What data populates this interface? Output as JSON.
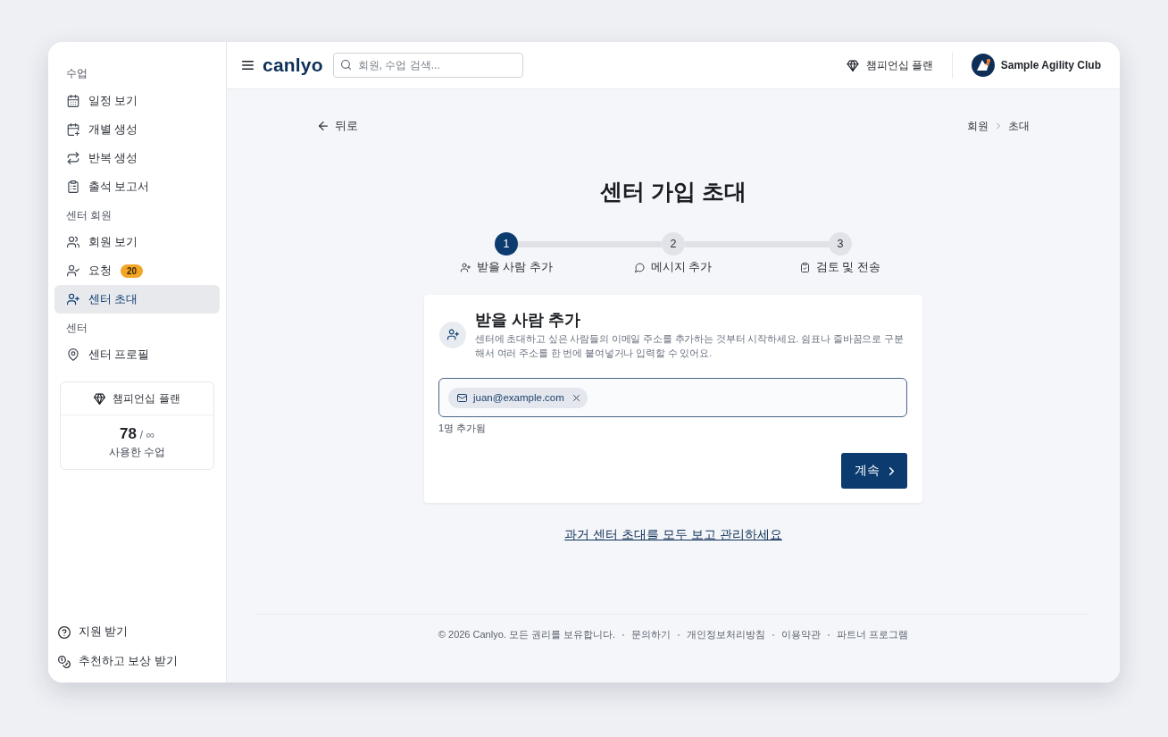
{
  "sidebar": {
    "sections": [
      {
        "heading": "수업",
        "items": [
          {
            "label": "일정 보기",
            "selected": false
          },
          {
            "label": "개별 생성",
            "selected": false
          },
          {
            "label": "반복 생성",
            "selected": false
          },
          {
            "label": "출석 보고서",
            "selected": false
          }
        ]
      },
      {
        "heading": "센터 회원",
        "items": [
          {
            "label": "회원 보기",
            "selected": false
          },
          {
            "label": "요청",
            "badge": "20",
            "selected": false
          },
          {
            "label": "센터 초대",
            "selected": true
          }
        ]
      },
      {
        "heading": "센터",
        "items": [
          {
            "label": "센터 프로필",
            "selected": false
          }
        ]
      }
    ],
    "plan_card": {
      "title": "챔피언십 플랜",
      "usage": "**78** / ∞",
      "caption": "사용한 수업"
    },
    "bottom_items": [
      "지원 받기",
      "추천하고 보상 받기"
    ]
  },
  "topbar": {
    "logo": "canlyo",
    "search": {
      "placeholder": "회원, 수업 검색..."
    },
    "plan": "챔피언십 플랜",
    "club": "Sample Agility Club"
  },
  "main": {
    "back": "뒤로",
    "breadcrumb": [
      "회원",
      "초대"
    ],
    "title": "센터 가입 초대",
    "steps": [
      {
        "number": "1",
        "label": "받을 사람 추가",
        "selected": true
      },
      {
        "number": "2",
        "label": "메시지 추가",
        "selected": false
      },
      {
        "number": "3",
        "label": "검토 및 전송",
        "selected": false
      }
    ],
    "card": {
      "title": "받을 사람 추가",
      "description": "센터에 초대하고 싶은 사람들의 이메일 주소를 추가하는 것부터 시작하세요. 쉼표나 줄바꿈으로 구분해서 여러 주소를 한 번에 붙여넣거나 입력할 수 있어요.",
      "recipients": [
        "juan@example.com"
      ],
      "count": "1명 추가됨",
      "button": "계속"
    },
    "link": "과거 센터 초대를 모두 보고 관리하세요"
  },
  "footer": {
    "copyright": "© 2026 Canlyo. 모든 권리를 보유합니다.",
    "links": [
      "문의하기",
      "개인정보처리방침",
      "이용약관",
      "파트너 프로그램"
    ]
  }
}
